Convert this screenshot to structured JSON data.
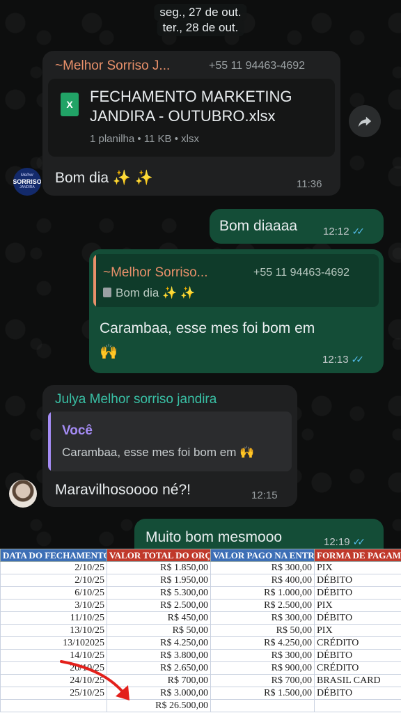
{
  "date_separators": [
    "seg., 27 de out.",
    "ter., 28 de out."
  ],
  "messages": {
    "m1": {
      "sender": "~Melhor Sorriso J...",
      "phone": "+55 11 94463-4692",
      "file_name_line1": "FECHAMENTO MARKETING",
      "file_name_line2": "JANDIRA - OUTUBRO.xlsx",
      "file_meta": "1 planilha • 11 KB • xlsx",
      "file_icon_letter": "X",
      "text": "Bom dia ✨ ✨",
      "time": "11:36",
      "avatar_line1": "Melhor",
      "avatar_line2": "SORRISO",
      "avatar_line3": "JANDIRA"
    },
    "m2": {
      "text": "Bom diaaaa",
      "time": "12:12",
      "ticks": "✓✓"
    },
    "m3": {
      "quote_sender": "~Melhor Sorriso...",
      "quote_phone": "+55 11 94463-4692",
      "quote_text": "Bom dia ✨ ✨",
      "text_line1": "Carambaa, esse mes foi bom em",
      "text_line2": "🙌",
      "time": "12:13",
      "ticks": "✓✓"
    },
    "m4": {
      "sender": "Julya Melhor sorriso jandira",
      "quote_sender": "Você",
      "quote_text": "Carambaa, esse mes foi bom em 🙌",
      "text": "Maravilhosoooo né?!",
      "time": "12:15"
    },
    "m5": {
      "text": "Muito bom mesmooo",
      "time": "12:19",
      "ticks": "✓✓"
    }
  },
  "colors": {
    "incoming_bubble": "#1f2021",
    "outgoing_bubble": "#144d37",
    "sender_orange": "#e8906a",
    "sender_teal": "#39c0a5",
    "quote_purple": "#a58cf5",
    "read_ticks": "#53bdeb",
    "sheet_header_blue": "#3d6fb6",
    "sheet_header_red": "#c0392b"
  },
  "sheet": {
    "headers": [
      "DATA DO FECHAMENTO",
      "VALOR TOTAL DO ORÇAMENTO",
      "VALOR PAGO NA ENTRADA",
      "FORMA DE PAGAMENTO"
    ],
    "rows": [
      [
        "2/10/25",
        "R$ 1.850,00",
        "R$ 300,00",
        "PIX"
      ],
      [
        "2/10/25",
        "R$ 1.950,00",
        "R$ 400,00",
        "DÉBITO"
      ],
      [
        "6/10/25",
        "R$ 5.300,00",
        "R$ 1.000,00",
        "DÉBITO"
      ],
      [
        "3/10/25",
        "R$ 2.500,00",
        "R$ 2.500,00",
        "PIX"
      ],
      [
        "11/10/25",
        "R$ 450,00",
        "R$ 300,00",
        "DÉBITO"
      ],
      [
        "13/10/25",
        "R$ 50,00",
        "R$ 50,00",
        "PIX"
      ],
      [
        "13/102025",
        "R$ 4.250,00",
        "R$ 4.250,00",
        "CRÉDITO"
      ],
      [
        "14/10/25",
        "R$ 3.800,00",
        "R$ 300,00",
        "DÉBITO"
      ],
      [
        "20/10/25",
        "R$ 2.650,00",
        "R$ 900,00",
        "CRÉDITO"
      ],
      [
        "24/10/25",
        "R$ 700,00",
        "R$ 700,00",
        "BRASIL CARD"
      ],
      [
        "25/10/25",
        "R$ 3.000,00",
        "R$ 1.500,00",
        "DÉBITO"
      ]
    ],
    "total": "R$ 26.500,00"
  }
}
